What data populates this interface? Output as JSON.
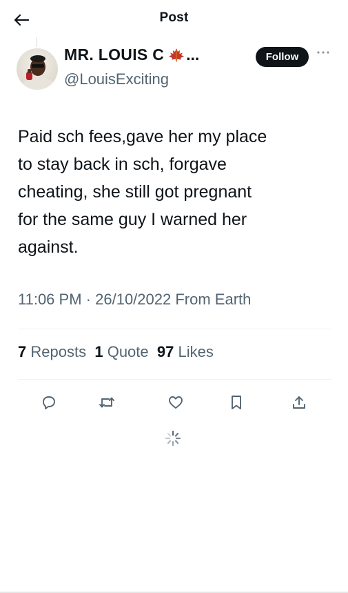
{
  "header": {
    "title": "Post",
    "back_icon": "arrow-left-icon"
  },
  "author": {
    "display_name": "MR. LOUIS C",
    "name_suffix": "...",
    "handle": "@LouisExciting",
    "badge_icon": "maple-leaf-icon",
    "follow_label": "Follow",
    "more_icon": "more-horizontal-icon"
  },
  "post": {
    "lines": [
      "Paid sch fees,gave her my place",
      "to stay back in sch, forgave",
      "cheating, she still got pregnant",
      "for the same guy I warned her",
      "against."
    ],
    "time": "11:06 PM",
    "separator": "·",
    "date": "26/10/2022",
    "source": "From Earth"
  },
  "stats": {
    "reposts_count": "7",
    "reposts_label": "Reposts",
    "quotes_count": "1",
    "quotes_label": "Quote",
    "likes_count": "97",
    "likes_label": "Likes"
  },
  "actions": [
    "reply-icon",
    "repost-icon",
    "like-icon",
    "bookmark-icon",
    "share-icon"
  ],
  "colors": {
    "text_primary": "#0f1419",
    "text_secondary": "#536471",
    "divider": "#eff3f4",
    "follow_bg": "#0f1419",
    "leaf": "#c0392b"
  }
}
